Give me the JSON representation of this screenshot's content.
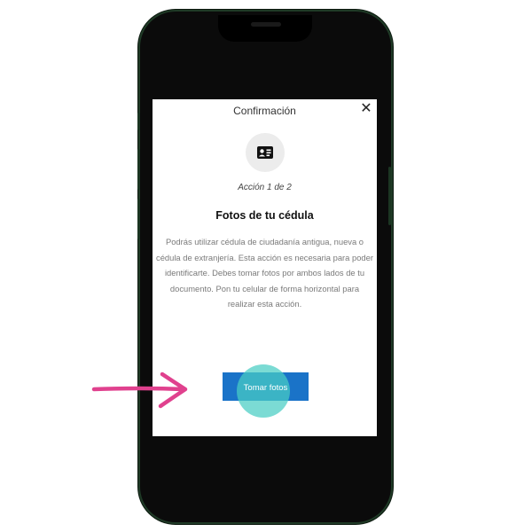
{
  "dialog": {
    "title": "Confirmación",
    "close_icon": "close-icon",
    "header_icon": "id-card-icon",
    "step": "Acción 1 de 2",
    "heading": "Fotos de tu cédula",
    "description": "Podrás utilizar cédula de ciudadanía antigua, nueva o cédula de extranjería. Esta acción es necesaria para poder identificarte. Debes tomar fotos por ambos lados de tu documento. Pon tu celular de forma horizontal para realizar esta acción.",
    "primary_button_label": "Tomar fotos"
  },
  "annotation": {
    "arrow_icon": "pointing-arrow-icon",
    "arrow_color": "#e0418e",
    "tap_indicator_color": "#48cdc3"
  },
  "colors": {
    "accent": "#1a73c8",
    "phone_frame": "#1f3a26"
  }
}
